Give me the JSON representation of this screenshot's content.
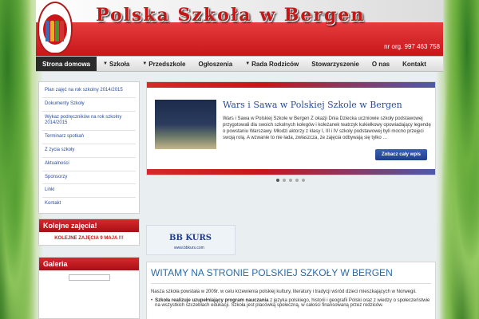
{
  "header": {
    "title": "Polska  Szkoła  w  Bergen",
    "phone": "nr org. 997 463 758"
  },
  "nav": {
    "items": [
      {
        "label": "Strona domowa",
        "active": true,
        "has_dropdown": false
      },
      {
        "label": "Szkoła",
        "active": false,
        "has_dropdown": true
      },
      {
        "label": "Przedszkole",
        "active": false,
        "has_dropdown": true
      },
      {
        "label": "Ogłoszenia",
        "active": false,
        "has_dropdown": false
      },
      {
        "label": "Rada Rodziców",
        "active": false,
        "has_dropdown": true
      },
      {
        "label": "Stowarzyszenie",
        "active": false,
        "has_dropdown": false
      },
      {
        "label": "O nas",
        "active": false,
        "has_dropdown": false
      },
      {
        "label": "Kontakt",
        "active": false,
        "has_dropdown": false
      }
    ]
  },
  "sidebar": {
    "menu": [
      "Plan zajęć na rok szkolny 2014/2015",
      "Dokumenty Szkoły",
      "Wykaz podręczników na rok szkolny 2014/2015",
      "Terminarz spotkań",
      "Z życia szkoły",
      "Aktualności",
      "Sponsorzy",
      "Linki",
      "Kontakt"
    ],
    "next_class": {
      "title": "Kolejne zajęcia!",
      "text": "KOLEJNE ZAJĘCIA 9 MAJA !!!"
    },
    "gallery": {
      "title": "Galeria"
    }
  },
  "slider": {
    "title": "Wars i Sawa w Polskiej Szkole w Bergen",
    "text": "Wars i Sawa w Polskiej Szkole w Bergen Z okazji Dnia Dziecka uczniowie szkoły podstawowej przygotowali dla swoich szkolnych kolegów i koleżanek teatrzyk kukiełkowy opowiadający legendę o powstaniu Warszawy. Młodzi aktorzy z klasy I, III i IV szkoły podstawowej byli mocno przejęci swoją rolą. A wzwanie to nie łada, zwłaszcza, że zajęcia odbywają się tylko …",
    "button": "Zobacz cały wpis",
    "dots": 5,
    "active_dot": 1
  },
  "banner": {
    "logo": "BB KURS",
    "url": "www.bbkurs.com"
  },
  "welcome": {
    "title": "WITAMY NA STRONIE POLSKIEJ SZKOŁY W BERGEN",
    "text": "Nasza szkoła powstała w 2009r. w celu krzewienia polskiej kultury, literatury i tradycji wśród dzieci mieszkających w Norwegii.",
    "bullet_bold": "Szkoła realizuje uzupełniający program nauczania",
    "bullet_text": " z języka polskiego, historii i geografii Polski oraz z wiedzy o społeczeństwie na wszystkich szczeblach edukacji. Szkoła jest placówką społeczną, w całości finansowaną przez rodziców."
  },
  "colors": {
    "accent": "#c8161b",
    "link": "#2a4c9b",
    "nav_active": "#2a2a2a"
  }
}
